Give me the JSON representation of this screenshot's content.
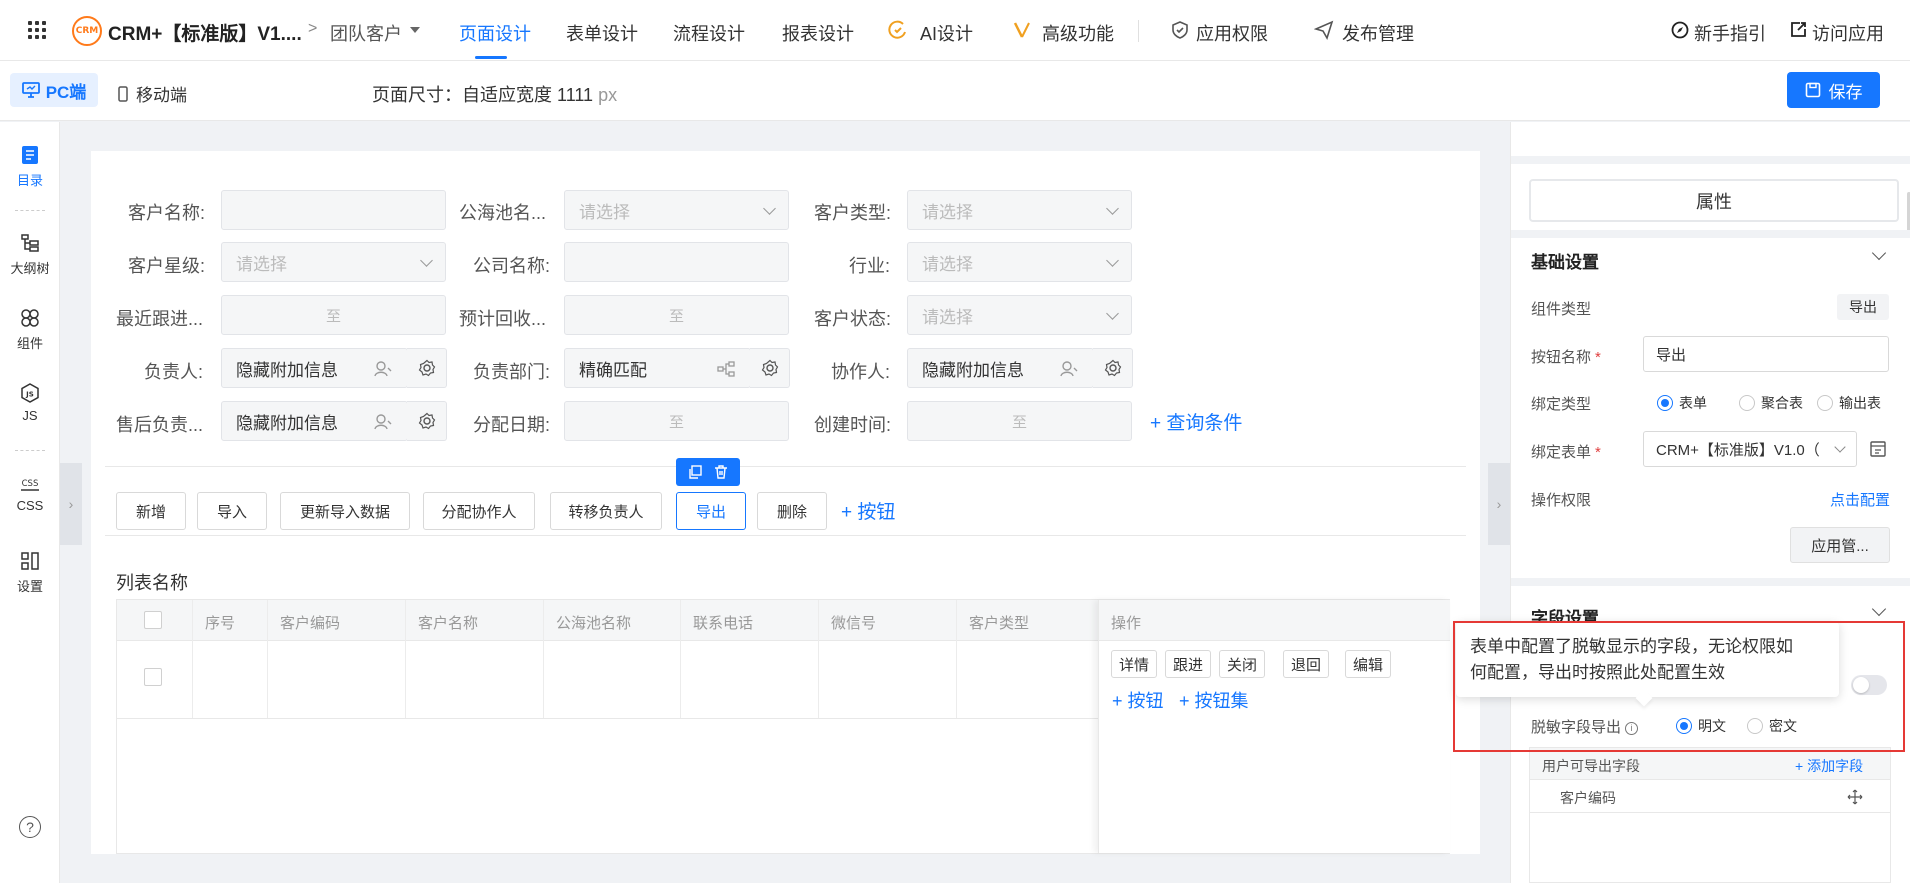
{
  "header": {
    "app_title": "CRM+【标准版】V1....",
    "breadcrumb": "团队客户",
    "tabs": [
      {
        "label": "页面设计"
      },
      {
        "label": "表单设计"
      },
      {
        "label": "流程设计"
      },
      {
        "label": "报表设计"
      },
      {
        "label": "AI设计"
      },
      {
        "label": "高级功能"
      },
      {
        "label": "应用权限"
      },
      {
        "label": "发布管理"
      }
    ],
    "guide": "新手指引",
    "visit": "访问应用",
    "logo_text": "CRM"
  },
  "subbar": {
    "pc": "PC端",
    "mobile": "移动端",
    "page_size_label": "页面尺寸：自适应宽度",
    "page_size_value": "1111",
    "page_size_unit": "px",
    "save": "保存"
  },
  "rail": [
    {
      "label": "目录"
    },
    {
      "label": "大纲树"
    },
    {
      "label": "组件"
    },
    {
      "label": "JS"
    },
    {
      "label": "CSS"
    },
    {
      "label": "设置"
    }
  ],
  "rail_help": "?",
  "form": {
    "rows": [
      [
        {
          "label": "客户名称:",
          "value": "",
          "kind": "text"
        },
        {
          "label": "公海池名...",
          "value": "请选择",
          "kind": "select"
        },
        {
          "label": "客户类型:",
          "value": "请选择",
          "kind": "select"
        }
      ],
      [
        {
          "label": "客户星级:",
          "value": "请选择",
          "kind": "select"
        },
        {
          "label": "公司名称:",
          "value": "",
          "kind": "text"
        },
        {
          "label": "行业:",
          "value": "请选择",
          "kind": "select"
        }
      ],
      [
        {
          "label": "最近跟进...",
          "value": "至",
          "kind": "range"
        },
        {
          "label": "预计回收...",
          "value": "至",
          "kind": "range"
        },
        {
          "label": "客户状态:",
          "value": "请选择",
          "kind": "select"
        }
      ],
      [
        {
          "label": "负责人:",
          "value": "隐藏附加信息",
          "kind": "user"
        },
        {
          "label": "负责部门:",
          "value": "精确匹配",
          "kind": "dept"
        },
        {
          "label": "协作人:",
          "value": "隐藏附加信息",
          "kind": "user"
        }
      ],
      [
        {
          "label": "售后负责...",
          "value": "隐藏附加信息",
          "kind": "user"
        },
        {
          "label": "分配日期:",
          "value": "至",
          "kind": "range"
        },
        {
          "label": "创建时间:",
          "value": "至",
          "kind": "range"
        }
      ]
    ],
    "query_link": "+ 查询条件"
  },
  "buttons": {
    "items": [
      {
        "label": "新增"
      },
      {
        "label": "导入"
      },
      {
        "label": "更新导入数据"
      },
      {
        "label": "分配协作人"
      },
      {
        "label": "转移负责人"
      },
      {
        "label": "导出"
      },
      {
        "label": "删除"
      }
    ],
    "add_link": "+ 按钮",
    "selected": "导出"
  },
  "list": {
    "title": "列表名称",
    "columns": [
      "序号",
      "客户编码",
      "客户名称",
      "公海池名称",
      "联系电话",
      "微信号",
      "客户类型"
    ],
    "op_header": "操作",
    "op_buttons": [
      "详情",
      "跟进",
      "关闭",
      "退回",
      "编辑"
    ],
    "op_add_button": "+ 按钮",
    "op_add_group": "+ 按钮集"
  },
  "panel": {
    "tab": "属性",
    "basic_title": "基础设置",
    "component_type_label": "组件类型",
    "component_type_value": "导出",
    "button_name_label": "按钮名称",
    "button_name_value": "导出",
    "bind_type_label": "绑定类型",
    "bind_type_options": [
      "表单",
      "聚合表",
      "输出表"
    ],
    "bind_form_label": "绑定表单",
    "bind_form_value": "CRM+【标准版】V1.0（",
    "permission_label": "操作权限",
    "permission_link": "点击配置",
    "app_manage": "应用管...",
    "field_title": "字段设置",
    "desensitize_label": "脱敏字段导出",
    "desensitize_options": [
      "明文",
      "密文"
    ],
    "export_fields_label": "用户可导出字段",
    "add_field": "+ 添加字段",
    "field_item": "客户编码",
    "required_mark": "*"
  },
  "tooltip": {
    "line1": "表单中配置了脱敏显示的字段，无论权限如",
    "line2": "何配置，导出时按照此处配置生效"
  },
  "colors": {
    "accent": "#1677ff",
    "annotation": "#e53935",
    "logo": "#ff7a1a"
  }
}
